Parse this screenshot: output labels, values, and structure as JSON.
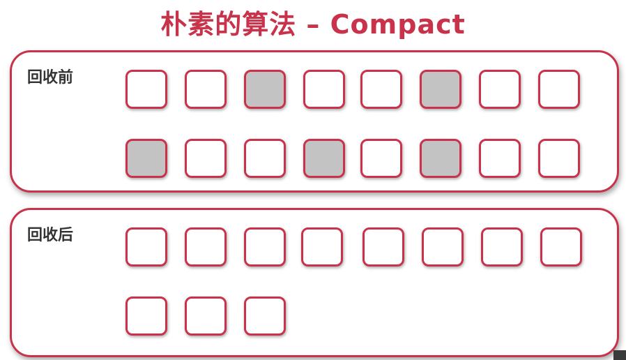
{
  "title": "朴素的算法 – Compact",
  "colors": {
    "accent": "#c8324a",
    "garbage_fill": "#c3c3c3",
    "live_fill": "#ffffff"
  },
  "before": {
    "label": "回收前",
    "rows": [
      [
        "live",
        "live",
        "garbage",
        "live",
        "live",
        "garbage",
        "live",
        "live"
      ],
      [
        "garbage",
        "live",
        "live",
        "garbage",
        "live",
        "garbage",
        "live",
        "live"
      ]
    ]
  },
  "after": {
    "label": "回收后",
    "rows": [
      [
        "live",
        "live",
        "live",
        "live",
        "live",
        "live",
        "live",
        "live"
      ],
      [
        "live",
        "live",
        "live"
      ]
    ]
  }
}
